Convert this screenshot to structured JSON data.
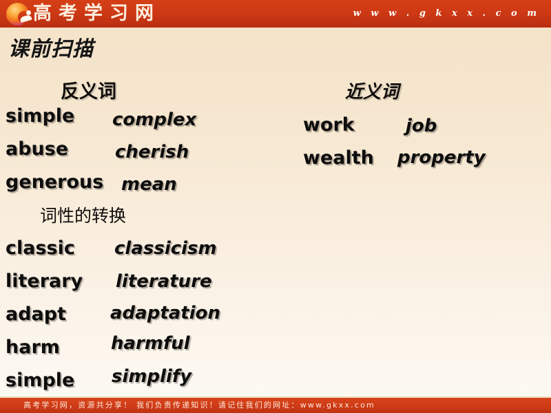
{
  "header": {
    "logo_icon": "gkxx-circle-logo-icon",
    "brand": "高考学习网",
    "url": "w w w . g k x x . c o m",
    "background_color": "#c83614"
  },
  "slide": {
    "title": "课前扫描",
    "background_top_color": "#f4e2c7",
    "background_bottom_color": "#fdfaf5"
  },
  "sections": {
    "antonyms": {
      "heading": "反义词",
      "pairs": [
        {
          "base": "simple",
          "counterpart": "complex"
        },
        {
          "base": "abuse",
          "counterpart": "cherish"
        },
        {
          "base": "generous",
          "counterpart": "mean"
        }
      ]
    },
    "synonyms": {
      "heading": "近义词",
      "pairs": [
        {
          "base": "work",
          "counterpart": "job"
        },
        {
          "base": "wealth",
          "counterpart": "property"
        }
      ]
    },
    "conversion": {
      "heading": "词性的转换",
      "pairs": [
        {
          "base": "classic",
          "counterpart": "classicism"
        },
        {
          "base": "literary",
          "counterpart": "literature"
        },
        {
          "base": "adapt",
          "counterpart": "adaptation"
        },
        {
          "base": "harm",
          "counterpart": "harmful"
        },
        {
          "base": "simple",
          "counterpart": "simplify"
        }
      ]
    }
  },
  "footer": {
    "text": "高考学习网，资源共分享！ 我们负责传递知识！请记住我们的网址：www.gkxx.com",
    "background_color": "#cb3a16"
  }
}
